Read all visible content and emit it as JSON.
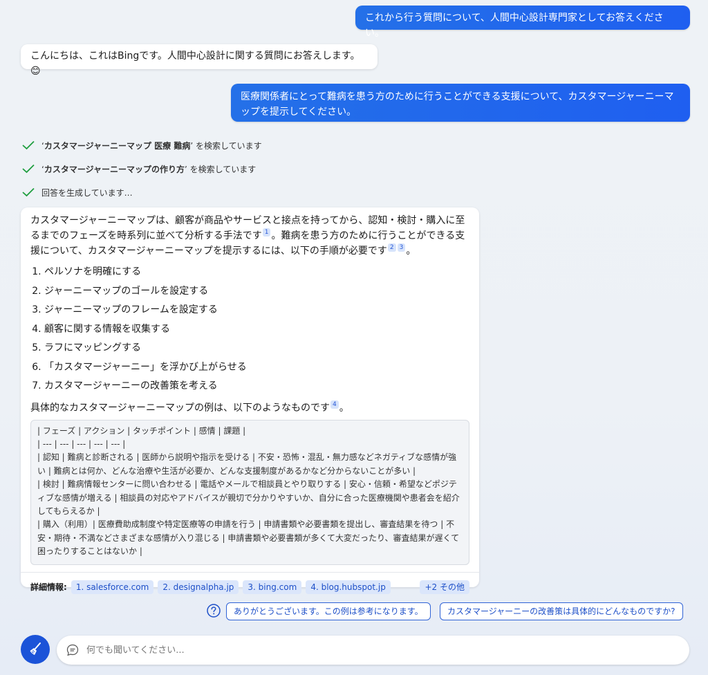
{
  "messages": {
    "user1": "これから行う質問について、人間中心設計専門家としてお答えください。",
    "bot1": "こんにちは、これはBingです。人間中心設計に関する質問にお答えします。",
    "bot1_emoji": "😊",
    "user2": "医療関係者にとって難病を患う方のために行うことができる支援について、カスタマージャーニーマップを提示してください。"
  },
  "status": [
    {
      "query": "カスタマージャーニーマップ 医療 難病",
      "suffix": " を検索しています"
    },
    {
      "query": "カスタマージャーニーマップの作り方",
      "suffix": " を検索しています"
    },
    {
      "text": "回答を生成しています…"
    }
  ],
  "answer": {
    "intro_1": "カスタマージャーニーマップは、顧客が商品やサービスと接点を持ってから、認知・検討・購入に至るまでのフェーズを時系列に並べて分析する手法です",
    "ref_1": "1",
    "intro_2": "。難病を患う方のために行うことができる支援について、カスタマージャーニーマップを提示するには、以下の手順が必要です",
    "ref_2": "2",
    "ref_3": "3",
    "intro_end": "。",
    "steps": [
      "ペルソナを明確にする",
      "ジャーニーマップのゴールを設定する",
      "ジャーニーマップのフレームを設定する",
      "顧客に関する情報を収集する",
      "ラフにマッピングする",
      "「カスタマージャーニー」を浮かび上がらせる",
      "カスタマージャーニーの改善策を考える"
    ],
    "example_text": "具体的なカスタマージャーニーマップの例は、以下のようなものです",
    "ref_4": "4",
    "example_end": "。",
    "table_lines": [
      "| フェーズ | アクション | タッチポイント | 感情 | 課題 |",
      "| --- | --- | --- | --- | --- |",
      "| 認知 | 難病と診断される | 医師から説明や指示を受ける | 不安・恐怖・混乱・無力感などネガティブな感情が強い | 難病とは何か、どんな治療や生活が必要か、どんな支援制度があるかなど分からないことが多い |",
      "| 検討 | 難病情報センターに問い合わせる | 電話やメールで相談員とやり取りする | 安心・信頼・希望などポジティブな感情が増える | 相談員の対応やアドバイスが親切で分かりやすいか、自分に合った医療機関や患者会を紹介してもらえるか |",
      "| 購入（利用）| 医療費助成制度や特定医療等の申請を行う | 申請書類や必要書類を提出し、審査結果を待つ | 不安・期待・不満などさまざまな感情が入り混じる | 申請書類や必要書類が多くて大変だったり、審査結果が遅くて困ったりすることはないか |"
    ],
    "learn_more_label": "詳細情報:",
    "sources": [
      "1. salesforce.com",
      "2. designalpha.jp",
      "3. bing.com",
      "4. blog.hubspot.jp"
    ],
    "more_sources": "+2 その他"
  },
  "suggestions": [
    "ありがとうございます。この例は参考になります。",
    "カスタマージャーニーの改善策は具体的にどんなものですか?"
  ],
  "input": {
    "placeholder": "何でも聞いてください..."
  },
  "colors": {
    "accent": "#1f5ff0",
    "check": "#1e9e3e",
    "chip_bg": "#dbe6fb"
  }
}
